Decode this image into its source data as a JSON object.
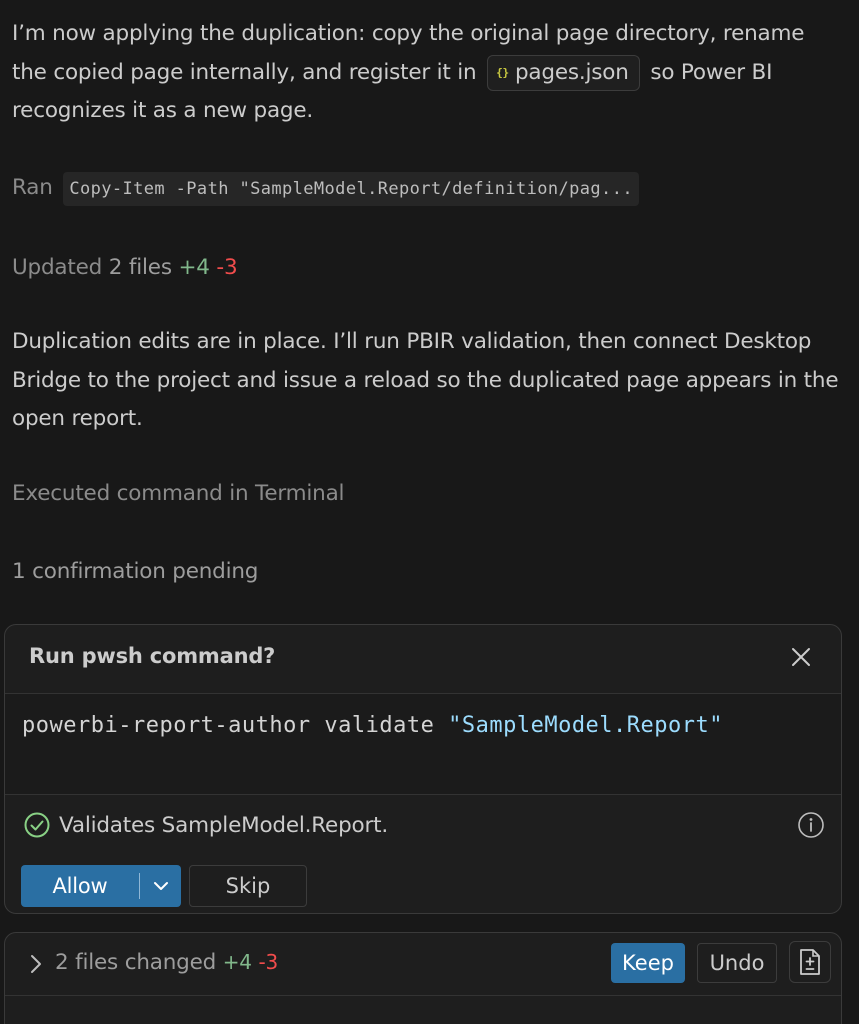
{
  "messages": {
    "p1_before": "I’m now applying the duplication: copy the original page directory, rename the copied page internally, and register it in",
    "p1_file": "pages.json",
    "p1_after": "so Power BI recognizes it as a new page.",
    "ran_label": "Ran",
    "ran_command": "Copy-Item -Path \"SampleModel.Report/definition/pag...",
    "updated_label": "Updated",
    "updated_files": "2 files",
    "updated_plus": "+4",
    "updated_minus": "-3",
    "p2": "Duplication edits are in place. I’ll run PBIR validation, then connect Desktop Bridge to the project and issue a reload so the duplicated page appears in the open report.",
    "executed_label": "Executed",
    "executed_rest": "command in Terminal",
    "pending": "1 confirmation pending"
  },
  "confirmation": {
    "title": "Run pwsh command?",
    "command_plain": "powerbi-report-author validate ",
    "command_string": "\"SampleModel.Report\"",
    "description": "Validates SampleModel.Report.",
    "allow_label": "Allow",
    "skip_label": "Skip"
  },
  "changes": {
    "label": "2 files changed",
    "plus": "+4",
    "minus": "-3",
    "keep_label": "Keep",
    "undo_label": "Undo"
  },
  "colors": {
    "background": "#181818",
    "primary_button": "#2a6fa3",
    "added": "#81b88b",
    "removed": "#f14c4c",
    "success": "#89d185",
    "string": "#9cdcfe"
  },
  "icons": {
    "json_file": "{}",
    "close": "close-icon",
    "check": "check-circle-icon",
    "info": "info-icon",
    "chevron_down": "chevron-down-icon",
    "chevron_right": "chevron-right-icon",
    "diff": "diff-icon"
  }
}
